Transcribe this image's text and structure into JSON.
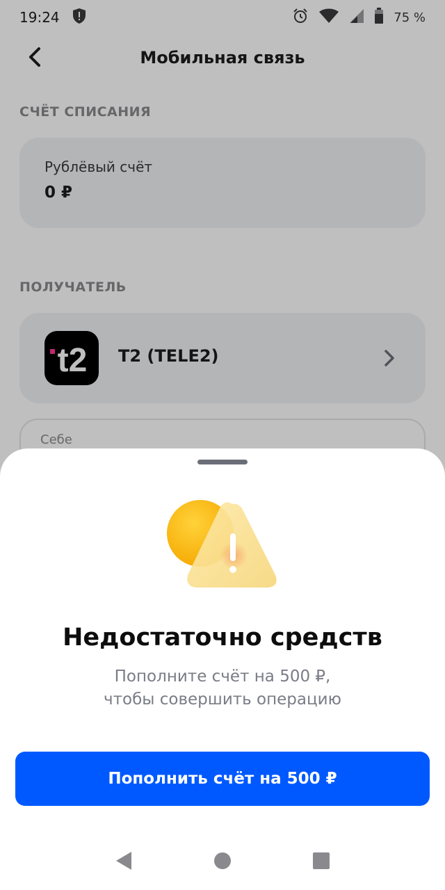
{
  "status_bar": {
    "time": "19:24",
    "battery": "75 %",
    "icons": [
      "shield-icon",
      "alarm-icon",
      "wifi-icon",
      "signal-icon",
      "battery-icon"
    ]
  },
  "header": {
    "title": "Мобильная связь",
    "back_icon": "chevron-left-icon"
  },
  "debit_section": {
    "title": "СЧЁТ СПИСАНИЯ",
    "account_name": "Рублёвый счёт",
    "balance": "0 ₽"
  },
  "recipient_section": {
    "title": "ПОЛУЧАТЕЛЬ",
    "operator_name": "T2 (TELE2)",
    "logo_text": "t2",
    "phone_label": "Себе"
  },
  "sheet": {
    "title": "Недостаточно средств",
    "message_line1": "Пополните счёт на 500 ₽,",
    "message_line2": "чтобы совершить операцию",
    "button_label": "Пополнить счёт на 500 ₽"
  },
  "colors": {
    "accent": "#0059ff",
    "warning": "#f7b500"
  },
  "nav_bar": {
    "icons": [
      "back-triangle-icon",
      "home-circle-icon",
      "recents-square-icon"
    ]
  }
}
